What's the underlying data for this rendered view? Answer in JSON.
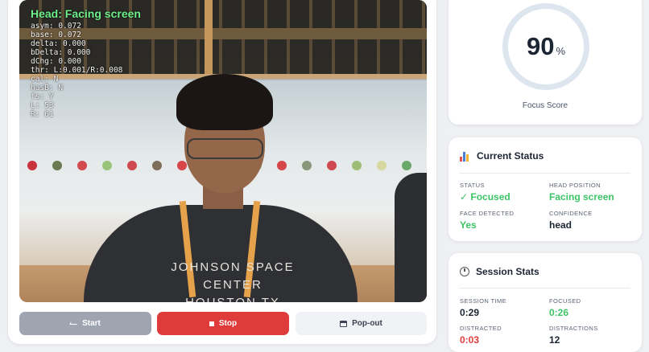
{
  "video": {
    "head_status": "Head: Facing screen",
    "debug_lines": [
      "asym: 0.072",
      "base: 0.072",
      "delta: 0.000",
      "bDelta: 0.000",
      "dChg: 0.000",
      "thr: L:0.001/R:0.008",
      "cal: N",
      "hasB: N",
      "fs: Y",
      "L: 53",
      "R: 61"
    ],
    "shirt_text": [
      "JOHNSON SPACE CENTER",
      "HOUSTON TX"
    ],
    "dot_colors": [
      "#c8333e",
      "#6a7a52",
      "#d24a4e",
      "#9ac37a",
      "#cf4a4e",
      "#7e6f5a",
      "#d8454a",
      "#b7c98a",
      "#c6443f",
      "#a2c27e",
      "#d5454a",
      "#88977a",
      "#cf4a4e",
      "#9ebe78",
      "#d7d8a0",
      "#6aa86a"
    ]
  },
  "controls": {
    "start_label": "Start",
    "stop_label": "Stop",
    "popout_label": "Pop-out"
  },
  "focus": {
    "score": "90",
    "unit": "%",
    "label": "Focus Score",
    "ring_color": "#dde5ef"
  },
  "current_status": {
    "title": "Current Status",
    "status_label": "STATUS",
    "status_value": "✓ Focused",
    "head_position_label": "HEAD POSITION",
    "head_position_value": "Facing screen",
    "face_detected_label": "FACE DETECTED",
    "face_detected_value": "Yes",
    "confidence_label": "CONFIDENCE",
    "confidence_value": "head"
  },
  "session_stats": {
    "title": "Session Stats",
    "session_time_label": "SESSION TIME",
    "session_time_value": "0:29",
    "focused_label": "FOCUSED",
    "focused_value": "0:26",
    "distracted_label": "DISTRACTED",
    "distracted_value": "0:03",
    "distractions_label": "DISTRACTIONS",
    "distractions_value": "12"
  },
  "colors": {
    "accent_green": "#3cc466",
    "accent_red": "#e03b3b",
    "stop_button": "#df3b3b",
    "start_button": "#9ea4b0"
  }
}
